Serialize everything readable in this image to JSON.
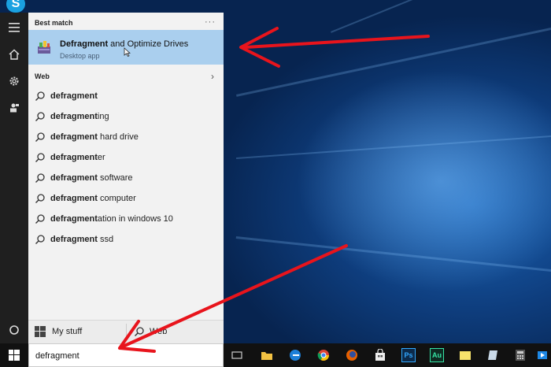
{
  "search": {
    "best_match_heading": "Best match",
    "more_options": "···",
    "best_match": {
      "name_bold": "Defragment",
      "name_rest": " and Optimize Drives",
      "type": "Desktop app",
      "icon": "defrag-drives-icon"
    },
    "web_heading": "Web",
    "suggestions": [
      {
        "bold": "defragment",
        "rest": ""
      },
      {
        "bold": "defragment",
        "rest": "ing"
      },
      {
        "bold": "defragment",
        "rest": " hard drive"
      },
      {
        "bold": "defragment",
        "rest": "er"
      },
      {
        "bold": "defragment",
        "rest": " software"
      },
      {
        "bold": "defragment",
        "rest": " computer"
      },
      {
        "bold": "defragment",
        "rest": "ation in windows 10"
      },
      {
        "bold": "defragment",
        "rest": " ssd"
      }
    ],
    "scopes": {
      "my_stuff": "My stuff",
      "web": "Web"
    },
    "query": "defragment"
  },
  "rail": {
    "icons": [
      "hamburger-icon",
      "home-icon",
      "settings-icon",
      "feedback-icon",
      "cortana-icon"
    ]
  },
  "taskbar": {
    "icons": [
      "task-view-icon",
      "file-explorer-icon",
      "edge-icon",
      "chrome-icon",
      "firefox-icon",
      "store-icon",
      "photoshop-icon",
      "audition-icon",
      "sticky-notes-icon",
      "app-icon",
      "calculator-icon",
      "movies-icon"
    ],
    "ps_label": "Ps",
    "au_label": "Au"
  },
  "colors": {
    "highlight": "#aacfee",
    "arrow": "#e8141c",
    "panel": "#f2f2f2",
    "taskbar": "#111111"
  }
}
